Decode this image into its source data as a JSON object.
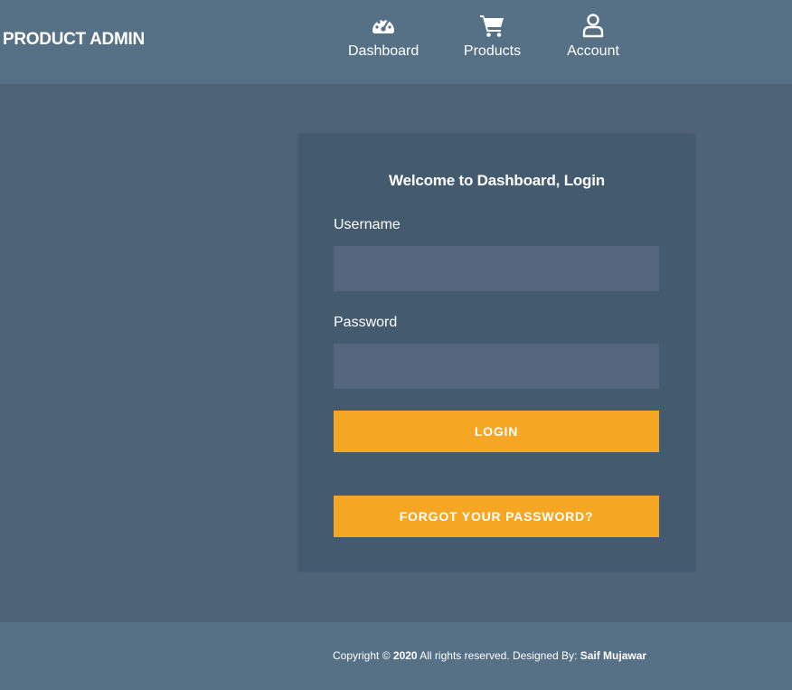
{
  "header": {
    "brand": "PRODUCT ADMIN",
    "nav": [
      {
        "label": "Dashboard",
        "icon": "speedometer-icon"
      },
      {
        "label": "Products",
        "icon": "shopping-cart-icon"
      },
      {
        "label": "Account",
        "icon": "user-icon"
      }
    ]
  },
  "login": {
    "title": "Welcome to Dashboard, Login",
    "username_label": "Username",
    "username_value": "",
    "password_label": "Password",
    "password_value": "",
    "login_button": "LOGIN",
    "forgot_button": "FORGOT YOUR PASSWORD?"
  },
  "footer": {
    "copyright_prefix": "Copyright ©",
    "year": "2020",
    "rights": "All rights reserved. Designed By:",
    "designer": "Saif Mujawar"
  },
  "colors": {
    "accent": "#f5a623",
    "header": "#567086",
    "background": "#4f6377",
    "card": "#435a6f",
    "input": "#54657e"
  }
}
